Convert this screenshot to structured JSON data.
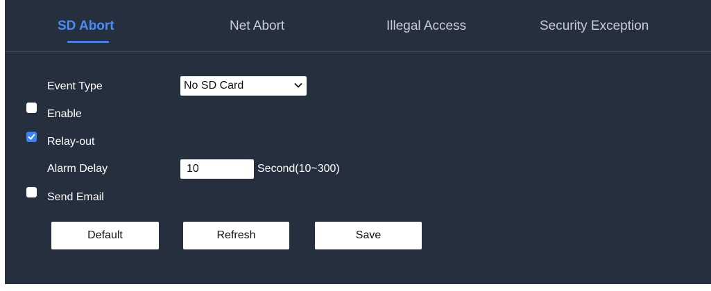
{
  "tabs": [
    {
      "label": "SD Abort",
      "active": true
    },
    {
      "label": "Net Abort",
      "active": false
    },
    {
      "label": "Illegal Access",
      "active": false
    },
    {
      "label": "Security Exception",
      "active": false
    }
  ],
  "form": {
    "event_type_label": "Event Type",
    "event_type_value": "No SD Card",
    "enable_label": "Enable",
    "enable_checked": false,
    "relay_out_label": "Relay-out",
    "relay_out_checked": true,
    "alarm_delay_label": "Alarm Delay",
    "alarm_delay_value": "10",
    "alarm_delay_unit": "Second(10~300)",
    "send_email_label": "Send Email",
    "send_email_checked": false
  },
  "buttons": {
    "default_label": "Default",
    "refresh_label": "Refresh",
    "save_label": "Save"
  },
  "colors": {
    "panel_bg": "#262f3e",
    "accent": "#3b82f6",
    "active_tab_text": "#4a8cf7",
    "inactive_tab_text": "#c9ced6"
  },
  "icons": {
    "select_arrow": "chevron-down-icon",
    "check": "checkmark-icon"
  }
}
